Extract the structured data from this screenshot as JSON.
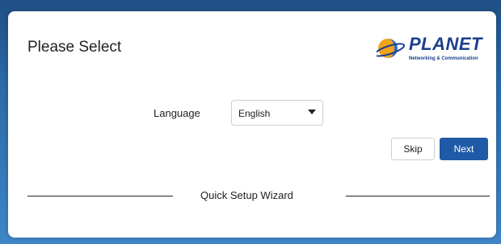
{
  "dialog": {
    "title": "Please Select"
  },
  "brand": {
    "name": "PLANET",
    "tagline": "Networking & Communication",
    "logo_icon": "planet-globe-icon",
    "colors": {
      "primary": "#1a3f8c",
      "accent_orange": "#f2a21b",
      "accent_blue": "#2f6fc8"
    }
  },
  "language": {
    "label": "Language",
    "selected": "English",
    "icon": "chevron-down-icon"
  },
  "actions": {
    "skip_label": "Skip",
    "next_label": "Next",
    "next_color": "#1e5aa6"
  },
  "footer": {
    "title": "Quick Setup Wizard"
  },
  "window": {
    "background_color": "#2b6aa8"
  }
}
